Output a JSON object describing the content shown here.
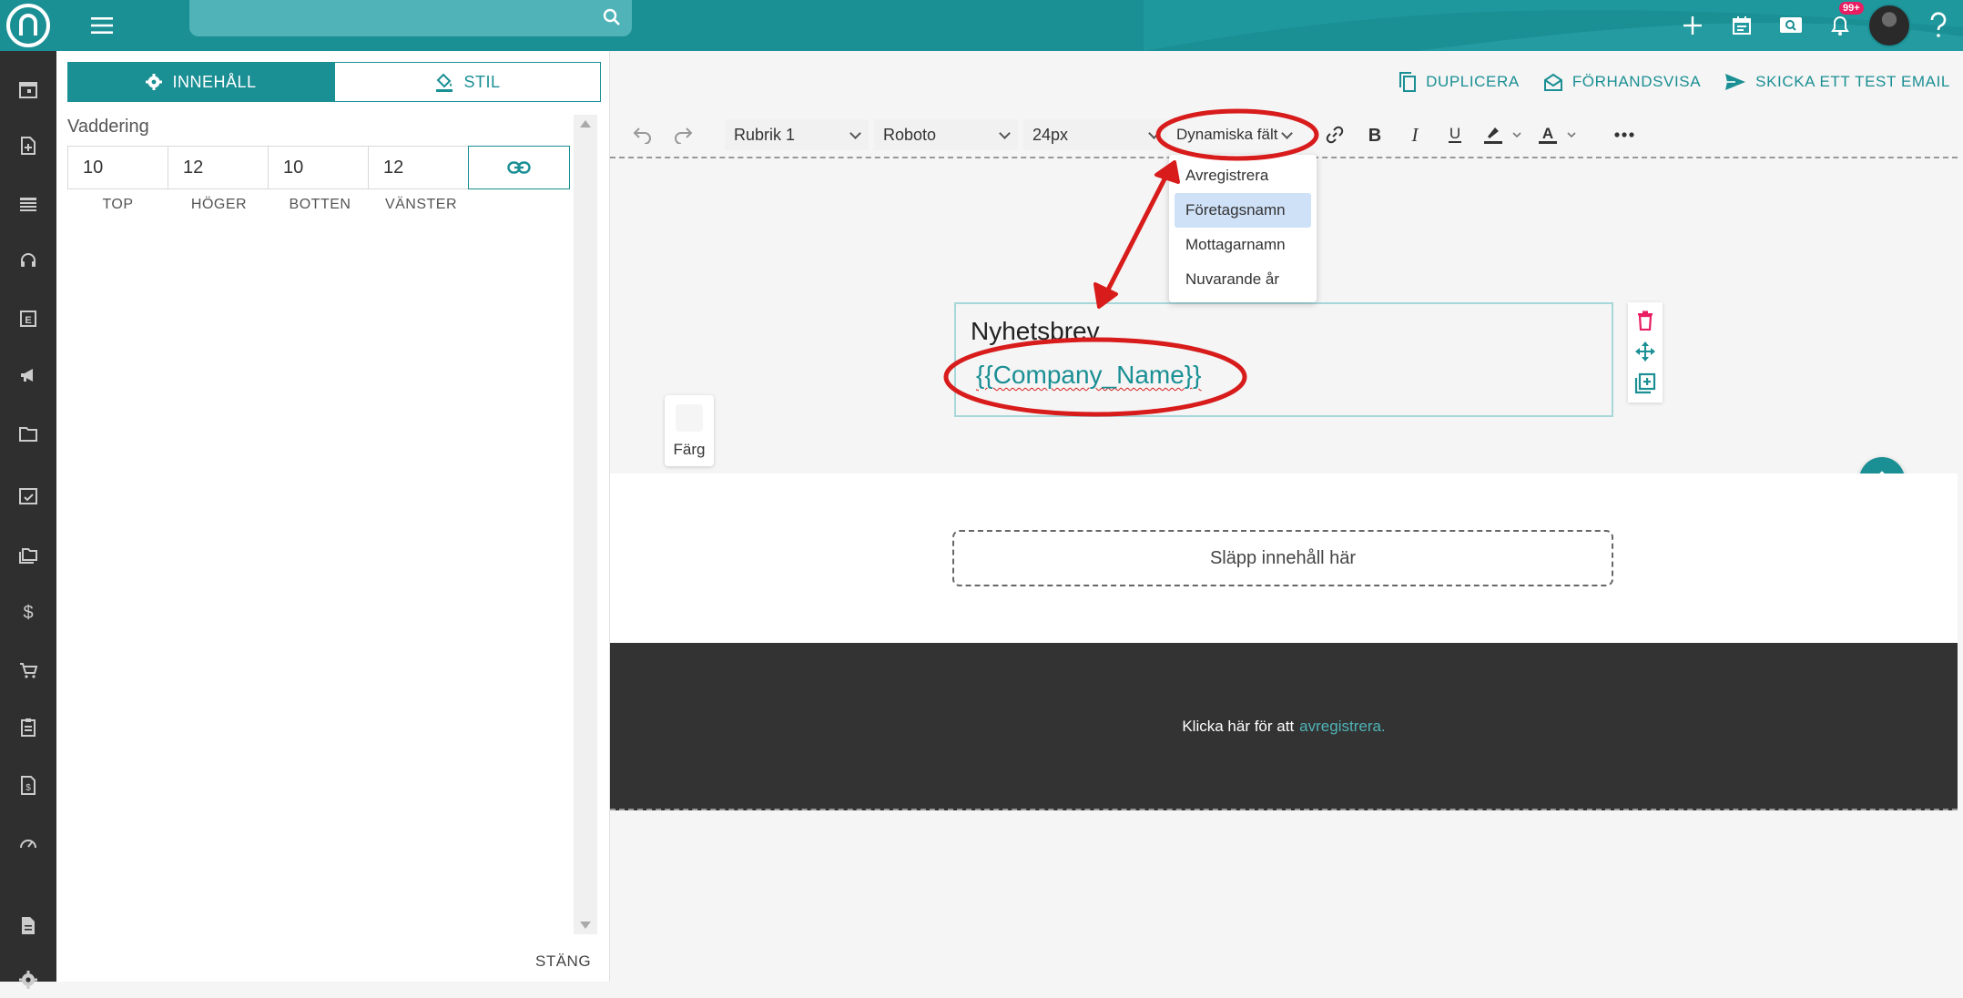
{
  "search": {
    "placeholder": ""
  },
  "topbar": {
    "notification_badge": "99+"
  },
  "panel": {
    "tabs": [
      {
        "label": "INNEHÅLL",
        "active": true,
        "icon": "gear-icon"
      },
      {
        "label": "STIL",
        "active": false,
        "icon": "paint-bucket-icon"
      }
    ],
    "padding_label": "Vaddering",
    "padding_values": {
      "top": "10",
      "right": "12",
      "bottom": "10",
      "left": "12"
    },
    "padding_names": [
      "TOP",
      "HÖGER",
      "BOTTEN",
      "VÄNSTER"
    ],
    "close_label": "STÄNG"
  },
  "actions": [
    {
      "label": "DUPLICERA",
      "icon": "copy-icon"
    },
    {
      "label": "FÖRHANDSVISA",
      "icon": "envelope-open-icon"
    },
    {
      "label": "SKICKA ETT TEST EMAIL",
      "icon": "send-icon"
    }
  ],
  "toolbar": {
    "block_format": "Rubrik 1",
    "font_family": "Roboto",
    "font_size": "24px",
    "dynamic_fields": "Dynamiska fält"
  },
  "dynamic_menu": {
    "items": [
      "Avregistrera",
      "Företagsnamn",
      "Mottagarnamn",
      "Nuvarande år"
    ],
    "highlighted": "Företagsnamn"
  },
  "canvas": {
    "heading": "Nyhetsbrev",
    "merge_tag": "{{Company_Name}}",
    "color_label": "Färg",
    "drop_zone": "Släpp innehåll här",
    "footer_text": "Klicka här för att",
    "footer_link": "avregistrera."
  },
  "colors": {
    "accent": "#1a8f94",
    "topbar": "#1a8f94",
    "rail": "#2f2f2f",
    "footer": "#333333",
    "annotation": "#d81b1b",
    "menu_highlight": "#cfe1f7"
  }
}
